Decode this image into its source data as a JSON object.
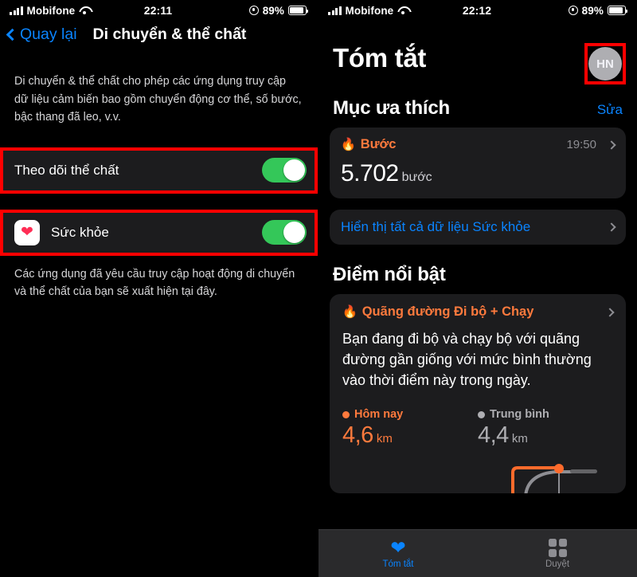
{
  "left": {
    "status": {
      "carrier": "Mobifone",
      "time": "22:11",
      "battery": "89%"
    },
    "nav": {
      "back_label": "Quay lại",
      "title": "Di chuyển & thể chất"
    },
    "intro": "Di chuyển & thể chất cho phép các ứng dụng truy cập dữ liệu cảm biến bao gồm chuyển động cơ thể, số bước, bậc thang đã leo, v.v.",
    "rows": [
      {
        "label": "Theo dõi thể chất",
        "toggle": "on",
        "icon": null,
        "highlighted": true
      },
      {
        "label": "Sức khỏe",
        "toggle": "on",
        "icon": "health-heart-icon",
        "highlighted": true
      }
    ],
    "footnote": "Các ứng dụng đã yêu cầu truy cập hoạt động di chuyển và thể chất của bạn sẽ xuất hiện tại đây."
  },
  "right": {
    "status": {
      "carrier": "Mobifone",
      "time": "22:12",
      "battery": "89%"
    },
    "title": "Tóm tắt",
    "avatar": {
      "initials": "HN",
      "highlighted": true
    },
    "favorites": {
      "section_title": "Mục ưa thích",
      "edit_label": "Sửa",
      "card": {
        "category": "Bước",
        "icon": "flame-icon",
        "time": "19:50",
        "value": "5.702",
        "unit": "bước"
      }
    },
    "show_all_link": "Hiển thị tất cả dữ liệu Sức khỏe",
    "highlights": {
      "section_title": "Điểm nổi bật",
      "card": {
        "category": "Quãng đường Đi bộ + Chạy",
        "icon": "flame-icon",
        "body": "Bạn đang đi bộ và chạy bộ với quãng đường gần giống với mức bình thường vào thời điểm này trong ngày.",
        "stats": [
          {
            "name": "Hôm nay",
            "value": "4,6",
            "unit": "km",
            "color": "#ff7a3d"
          },
          {
            "name": "Trung bình",
            "value": "4,4",
            "unit": "km",
            "color": "#aeaeb2"
          }
        ]
      }
    },
    "tabs": [
      {
        "label": "Tóm tắt",
        "icon": "heart-icon",
        "state": "active"
      },
      {
        "label": "Duyệt",
        "icon": "grid-icon",
        "state": "idle"
      }
    ]
  },
  "colors": {
    "highlight_box": "#ff0000",
    "toggle_on": "#34c759",
    "accent_blue": "#0a84ff",
    "accent_orange": "#ff7a3d",
    "card_bg": "#1c1c1e"
  }
}
